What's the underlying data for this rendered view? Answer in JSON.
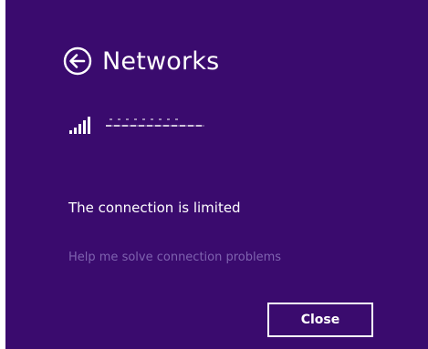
{
  "header": {
    "title": "Networks",
    "back_icon": "back-arrow-icon"
  },
  "network": {
    "signal_icon": "wifi-signal-icon",
    "name": ""
  },
  "status": {
    "message": "The connection is limited"
  },
  "help": {
    "link_text": "Help me solve connection problems"
  },
  "footer": {
    "close_label": "Close"
  },
  "colors": {
    "background": "#3a0b6e",
    "text": "#ffffff",
    "link": "#7f63b0"
  }
}
